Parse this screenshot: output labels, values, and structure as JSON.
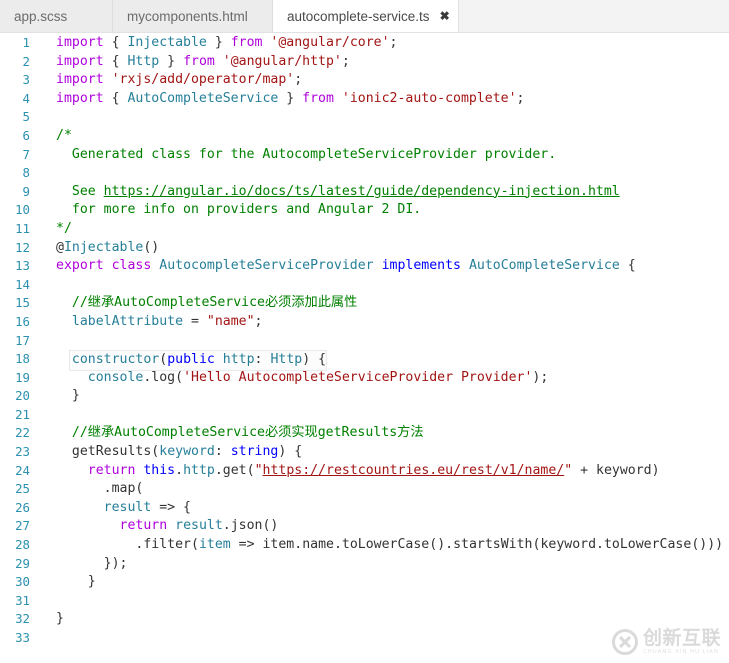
{
  "window": {
    "title": "autocomplete-service.ts",
    "type": "code-editor"
  },
  "tabs": [
    {
      "label": "app.scss",
      "active": false,
      "closable": false
    },
    {
      "label": "mycomponents.html",
      "active": false,
      "closable": false
    },
    {
      "label": "autocomplete-service.ts",
      "active": true,
      "closable": true,
      "close_icon": "close-icon",
      "close_glyph": "✖"
    }
  ],
  "editor": {
    "language": "typescript",
    "first_line": 1,
    "last_line": 33,
    "highlighted_line": 18,
    "colors": {
      "background": "#ffffff",
      "gutter_text": "#2b91af",
      "keyword": "#af00db",
      "keyword_alt": "#0000ff",
      "type": "#267f99",
      "string": "#a31515",
      "comment": "#008000",
      "plain": "#333333",
      "tabbar_active": "#ffffff",
      "tabbar_inactive": "#ececec"
    },
    "lines": [
      {
        "n": "1",
        "text": "import { Injectable } from '@angular/core';"
      },
      {
        "n": "2",
        "text": "import { Http } from '@angular/http';"
      },
      {
        "n": "3",
        "text": "import 'rxjs/add/operator/map';"
      },
      {
        "n": "4",
        "text": "import { AutoCompleteService } from 'ionic2-auto-complete';"
      },
      {
        "n": "5",
        "text": ""
      },
      {
        "n": "6",
        "text": "/*"
      },
      {
        "n": "7",
        "text": "  Generated class for the AutocompleteServiceProvider provider."
      },
      {
        "n": "8",
        "text": ""
      },
      {
        "n": "9",
        "text": "  See https://angular.io/docs/ts/latest/guide/dependency-injection.html"
      },
      {
        "n": "10",
        "text": "  for more info on providers and Angular 2 DI."
      },
      {
        "n": "11",
        "text": "*/"
      },
      {
        "n": "12",
        "text": "@Injectable()"
      },
      {
        "n": "13",
        "text": "export class AutocompleteServiceProvider implements AutoCompleteService {"
      },
      {
        "n": "14",
        "text": ""
      },
      {
        "n": "15",
        "text": "  //继承AutoCompleteService必须添加此属性"
      },
      {
        "n": "16",
        "text": "  labelAttribute = \"name\";"
      },
      {
        "n": "17",
        "text": ""
      },
      {
        "n": "18",
        "text": "  constructor(public http: Http) {"
      },
      {
        "n": "19",
        "text": "    console.log('Hello AutocompleteServiceProvider Provider');"
      },
      {
        "n": "20",
        "text": "  }"
      },
      {
        "n": "21",
        "text": ""
      },
      {
        "n": "22",
        "text": "  //继承AutoCompleteService必须实现getResults方法"
      },
      {
        "n": "23",
        "text": "  getResults(keyword: string) {"
      },
      {
        "n": "24",
        "text": "    return this.http.get(\"https://restcountries.eu/rest/v1/name/\" + keyword)"
      },
      {
        "n": "25",
        "text": "      .map("
      },
      {
        "n": "26",
        "text": "      result => {"
      },
      {
        "n": "27",
        "text": "        return result.json()"
      },
      {
        "n": "28",
        "text": "          .filter(item => item.name.toLowerCase().startsWith(keyword.toLowerCase()))"
      },
      {
        "n": "29",
        "text": "      });"
      },
      {
        "n": "30",
        "text": "    }"
      },
      {
        "n": "31",
        "text": ""
      },
      {
        "n": "32",
        "text": "}"
      },
      {
        "n": "33",
        "text": ""
      }
    ],
    "links": [
      "https://angular.io/docs/ts/latest/guide/dependency-injection.html",
      "https://restcountries.eu/rest/v1/name/"
    ]
  },
  "watermark": {
    "cn": "创新互联",
    "pinyin": "CHUANG XIN HU LIAN",
    "icon": "circled-x-logo-icon"
  }
}
